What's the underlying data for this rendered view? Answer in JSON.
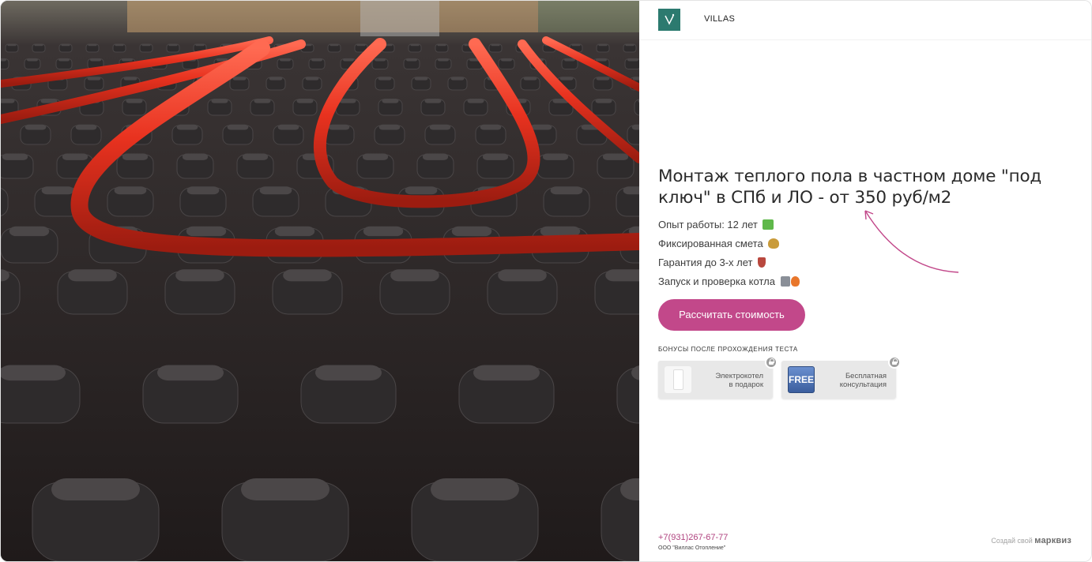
{
  "brand": {
    "name": "VILLAS",
    "logo_color": "#2c7a6f"
  },
  "hero": {
    "image_desc": "red underfloor heating pipes laid between black plastic bosses"
  },
  "heading": "Монтаж теплого пола в частном доме \"под ключ\" в СПб и ЛО - от 350 руб/м2",
  "features": [
    {
      "text": "Опыт работы: 12 лет",
      "icon": "check-mark-emoji-icon",
      "color": "#5fb84a"
    },
    {
      "text": "Фиксированная смета",
      "icon": "money-bag-emoji-icon",
      "color": "#c99b3a"
    },
    {
      "text": "Гарантия до 3-х лет",
      "icon": "shield-emoji-icon",
      "color": "#b9483e"
    },
    {
      "text": "Запуск и проверка котла",
      "icon": "wrench-fire-emoji-icon",
      "color": "#e8762b"
    }
  ],
  "cta": {
    "label": "Рассчитать стоимость",
    "color": "#c2488a"
  },
  "bonuses": {
    "label": "БОНУСЫ ПОСЛЕ ПРОХОЖДЕНИЯ ТЕСТА",
    "items": [
      {
        "line1": "Электрокотел",
        "line2": "в подарок",
        "thumb": "electric-boiler",
        "locked": true
      },
      {
        "line1": "Бесплатная",
        "line2": "консультация",
        "thumb_text": "FREE",
        "locked": true
      }
    ]
  },
  "footer": {
    "phone": "+7(931)267-67-77",
    "company": "ООО \"Виллас Отопление\"",
    "made_prefix": "Создай свой",
    "made_brand": "марквиз"
  },
  "colors": {
    "accent": "#c2488a",
    "pipe": "#e8321f"
  }
}
